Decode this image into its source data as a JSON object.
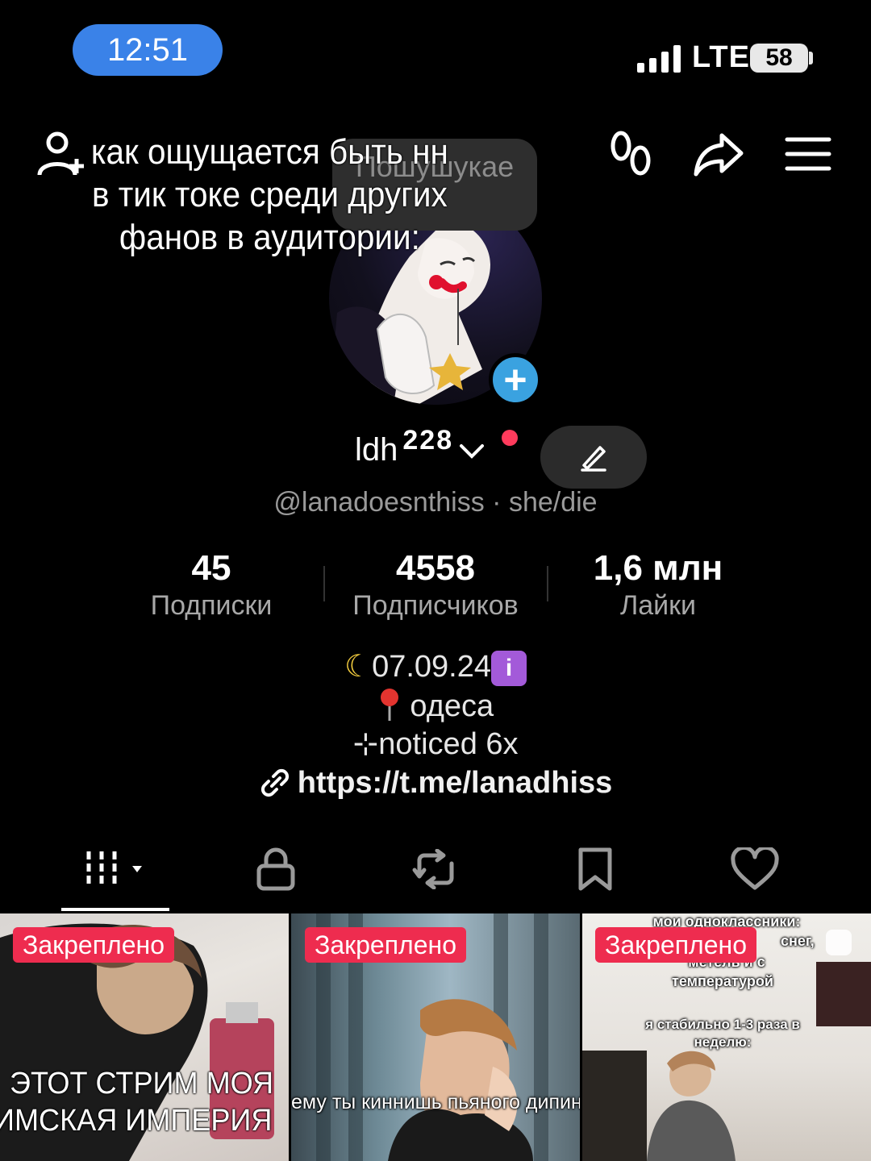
{
  "status_bar": {
    "time": "12:51",
    "network": "LTE",
    "battery": "58"
  },
  "caption": {
    "lines": [
      "как ощущается быть нн",
      "в тик токе среди других",
      "фанов в аудитории:"
    ]
  },
  "bubble_text": "Пошушукае",
  "profile": {
    "name": "ldh",
    "name_sup": "228",
    "handle": "@lanadoesnthiss · she/die"
  },
  "stats": [
    {
      "value": "45",
      "label": "Подписки"
    },
    {
      "value": "4558",
      "label": "Подписчиков"
    },
    {
      "value": "1,6 млн",
      "label": "Лайки"
    }
  ],
  "bio": {
    "line1": "07.09.24",
    "line2": "одеса",
    "line3": "⊹noticed 6x",
    "link": "https://t.me/lanadhiss"
  },
  "tabs": [
    "videos-tab",
    "private-tab",
    "reposts-tab",
    "favorites-tab",
    "liked-tab"
  ],
  "grid": [
    {
      "pin": "Закреплено",
      "overlay_top": "",
      "overlay_bottom_1": "ЭТОТ СТРИМ МОЯ",
      "overlay_bottom_2": "ИМСКАЯ ИМПЕРИЯ"
    },
    {
      "pin": "Закреплено",
      "overlay_bottom_1": "ему ты киннишь пьяного дипинс"
    },
    {
      "pin": "Закреплено",
      "overlay_top": "мои одноклассники:",
      "overlay_top_2": "снег,",
      "overlay_top_3": "метель и с",
      "overlay_top_4": "температурой",
      "overlay_mid_1": "я стабильно 1-3 раза в",
      "overlay_mid_2": "неделю:"
    }
  ],
  "colors": {
    "time_pill": "#3a82e8",
    "pin_badge": "#ee2c4f",
    "plus_badge": "#3aa2e0"
  }
}
